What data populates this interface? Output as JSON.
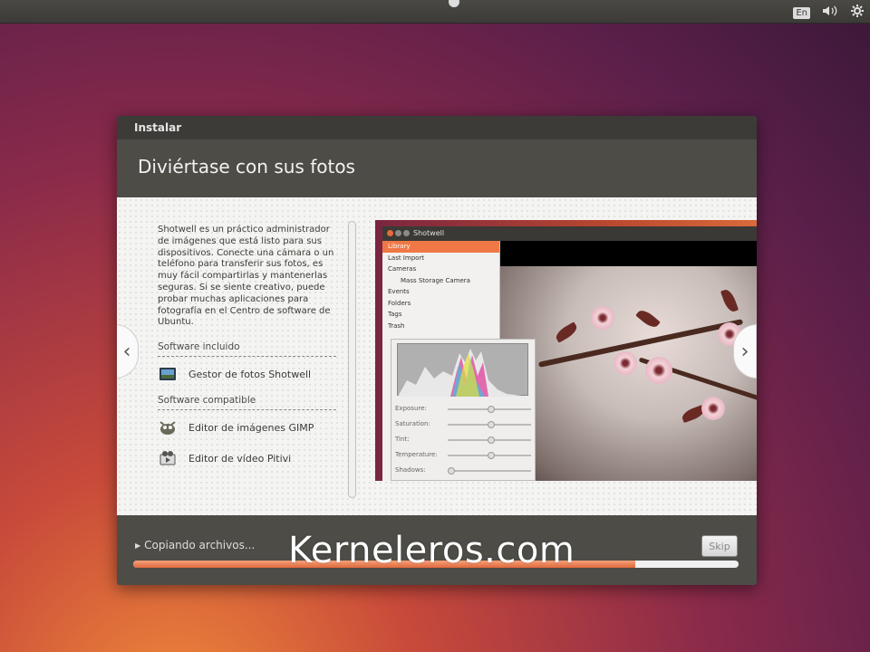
{
  "top_panel": {
    "keyboard_layout": "En",
    "volume_icon": "speaker-icon",
    "settings_icon": "gear-icon"
  },
  "window": {
    "title": "Instalar",
    "slide_heading": "Diviértase con sus fotos",
    "description": "Shotwell es un práctico administrador de imágenes que está listo para sus dispositivos. Conecte una cámara o un teléfono para transferir sus fotos, es muy fácil compartirlas y mantenerlas seguras. Si se siente creativo, puede probar muchas aplicaciones para fotografía en el Centro de software de Ubuntu.",
    "included_title": "Software incluido",
    "included_items": [
      "Gestor de fotos Shotwell"
    ],
    "compatible_title": "Software compatible",
    "compatible_items": [
      "Editor de imágenes GIMP",
      "Editor de vídeo Pitivi"
    ]
  },
  "shotwell": {
    "title": "Shotwell",
    "sidebar": [
      "Library",
      "Last Import",
      "Cameras",
      "Mass Storage Camera",
      "Events",
      "Folders",
      "Tags",
      "Trash"
    ],
    "adjustments": [
      "Exposure:",
      "Saturation:",
      "Tint:",
      "Temperature:",
      "Shadows:"
    ]
  },
  "bottom": {
    "status": "Copiando archivos...",
    "skip_label": "Skip",
    "progress_fraction": 0.83
  },
  "watermark": "Kerneleros.com",
  "colors": {
    "accent": "#e0683c",
    "panel": "#3c3b37",
    "header": "#4d4c47"
  }
}
